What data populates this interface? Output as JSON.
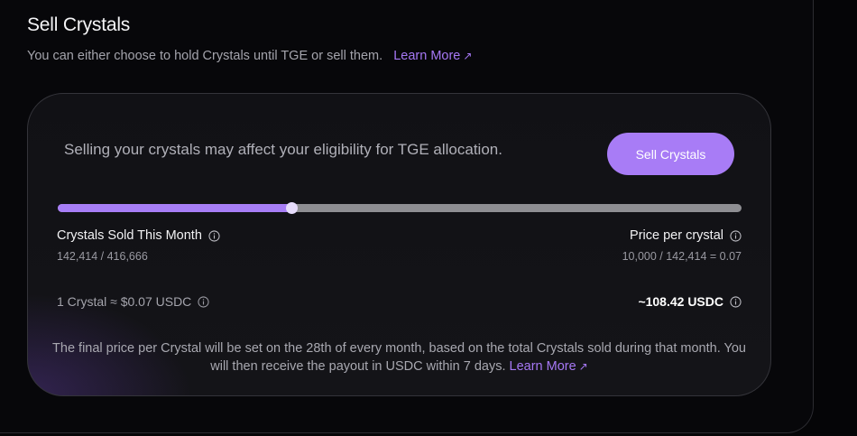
{
  "header": {
    "title": "Sell Crystals",
    "subtitle": "You can either choose to hold Crystals until TGE or sell them.",
    "learn_more": "Learn More",
    "learn_more_arrow": "↗"
  },
  "card": {
    "warning": "Selling your crystals may affect your eligibility for TGE allocation.",
    "sell_button": "Sell Crystals",
    "progress": {
      "sold": 142414,
      "total": 416666,
      "fraction": 0.3418
    },
    "sold_label": "Crystals Sold This Month",
    "sold_value": "142,414 / 416,666",
    "price_label": "Price per crystal",
    "price_value": "10,000 / 142,414 = 0.07",
    "rate": "1 Crystal ≈ $0.07 USDC",
    "total": "~108.42 USDC",
    "footer_note": "The final price per Crystal will be set on the 28th of every month, based on the total Crystals sold during that month. You will then receive the payout in USDC within 7 days.",
    "footer_learn_more": "Learn More",
    "footer_learn_more_arrow": "↗"
  },
  "colors": {
    "accent": "#a87cf6",
    "background": "#050507",
    "card": "#121216"
  },
  "icons": {
    "info": "info-circle-icon",
    "external": "external-link-arrow-icon"
  }
}
